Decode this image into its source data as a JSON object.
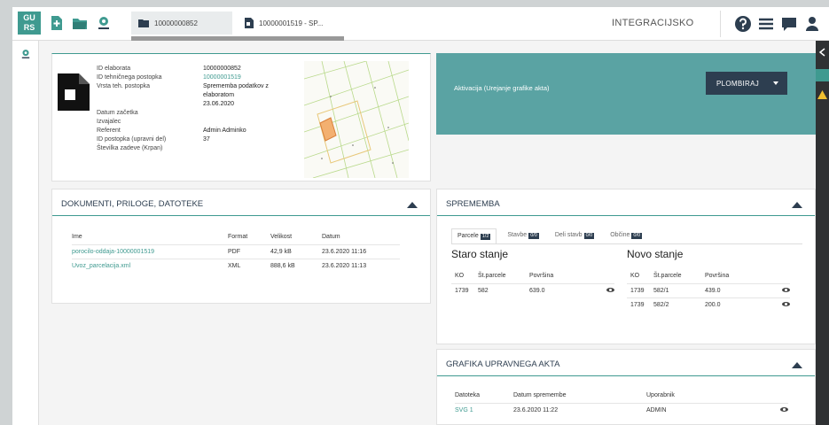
{
  "app": {
    "logo": "GU\nRS",
    "mode": "INTEGRACIJSKO",
    "progress": 1.0
  },
  "breadcrumbs": [
    {
      "label": "10000000852"
    },
    {
      "label": "10000001519 - SP..."
    }
  ],
  "info": {
    "labels": [
      "ID elaborata",
      "ID tehničnega postopka",
      "Vrsta teh. postopka",
      "",
      "",
      "Datum začetka",
      "Izvajalec",
      "Referent",
      "ID postopka (upravni del)",
      "Številka zadeve (Krpan)"
    ],
    "values": [
      "10000000852",
      "10000001519",
      "Sprememba podatkov z",
      "elaboratom",
      "23.06.2020",
      "",
      "",
      "Admin Adminko",
      "37",
      ""
    ]
  },
  "banner": {
    "text": "Aktivacija (Urejanje grafike akta)",
    "button": "PLOMBIRAJ"
  },
  "docs": {
    "title": "DOKUMENTI, PRILOGE, DATOTEKE",
    "columns": [
      "Ime",
      "Format",
      "Velikost",
      "Datum"
    ],
    "rows": [
      [
        "porocilo-oddaja-10000001519",
        "PDF",
        "42,9 kB",
        "23.6.2020 11:16"
      ],
      [
        "Uvoz_parcelacija.xml",
        "XML",
        "888,6 kB",
        "23.6.2020 11:13"
      ]
    ]
  },
  "sprememba": {
    "title": "SPREMEMBA",
    "tabs": [
      {
        "label": "Parcele",
        "badge": "1/2"
      },
      {
        "label": "Stavbe",
        "badge": "0/0"
      },
      {
        "label": "Deli stavb",
        "badge": "0/0"
      },
      {
        "label": "Občine",
        "badge": "0/0"
      }
    ],
    "old": {
      "title": "Staro stanje",
      "columns": [
        "KO",
        "Št.parcele",
        "Površina"
      ],
      "rows": [
        [
          "1739",
          "582",
          "639.0"
        ]
      ]
    },
    "new": {
      "title": "Novo stanje",
      "columns": [
        "KO",
        "Št.parcele",
        "Površina"
      ],
      "rows": [
        [
          "1739",
          "582/1",
          "439.0"
        ],
        [
          "1739",
          "582/2",
          "200.0"
        ]
      ]
    }
  },
  "grafika": {
    "title": "GRAFIKA UPRAVNEGA AKTA",
    "columns": [
      "Datoteka",
      "Datum spremembe",
      "Uporabnik"
    ],
    "rows": [
      [
        "SVG 1",
        "23.6.2020 11:22",
        "ADMIN"
      ]
    ]
  },
  "colors": {
    "accent": "#3f9a90",
    "banner": "#5aa3a3",
    "dark": "#2d3e50"
  }
}
